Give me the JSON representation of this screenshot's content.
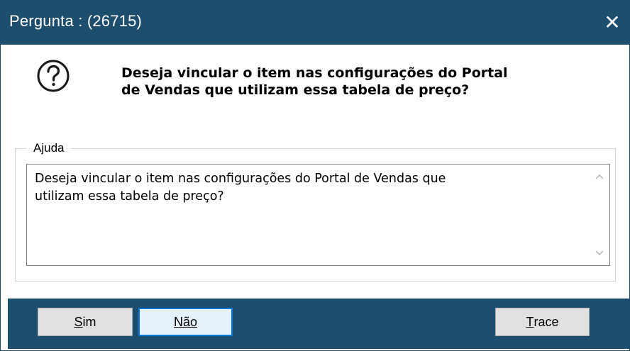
{
  "window": {
    "title": "Pergunta : (26715)",
    "close_symbol": "✕"
  },
  "question": {
    "icon": "question-circle-icon",
    "text_line1": "Deseja vincular o item nas configurações do Portal",
    "text_line2": "de Vendas que utilizam essa tabela de preço?"
  },
  "help": {
    "legend": "Ajuda",
    "text_line1": "Deseja vincular o item nas configurações do Portal de Vendas que",
    "text_line2": "utilizam essa tabela de preço?",
    "scroll_up": "⌃",
    "scroll_down": "⌄"
  },
  "buttons": {
    "sim_access": "S",
    "sim_rest": "im",
    "nao_access": "N",
    "nao_rest": "ão",
    "trace_access": "T",
    "trace_rest": "race"
  },
  "colors": {
    "titlebar": "#1e4e6e",
    "footer": "#1e4e6e",
    "focused_border": "#0078d7"
  }
}
